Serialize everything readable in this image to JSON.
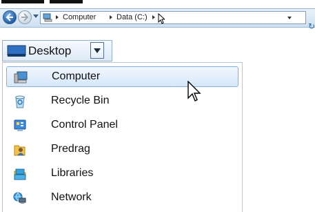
{
  "window": {
    "title": ""
  },
  "address_bar": {
    "crumbs": [
      "Computer",
      "Data (C:)"
    ]
  },
  "desktop_selector": {
    "label": "Desktop"
  },
  "dropdown": {
    "items": [
      {
        "label": "Computer",
        "icon": "computer-icon",
        "selected": true
      },
      {
        "label": "Recycle Bin",
        "icon": "recycle-bin-icon",
        "selected": false
      },
      {
        "label": "Control Panel",
        "icon": "control-panel-icon",
        "selected": false
      },
      {
        "label": "Predrag",
        "icon": "user-folder-icon",
        "selected": false
      },
      {
        "label": "Libraries",
        "icon": "libraries-icon",
        "selected": false
      },
      {
        "label": "Network",
        "icon": "network-icon",
        "selected": false
      }
    ]
  },
  "colors": {
    "selection_fill": "#d6e7fa",
    "selection_border": "#86aedb",
    "address_bar_bg": "#cfe0f1"
  }
}
